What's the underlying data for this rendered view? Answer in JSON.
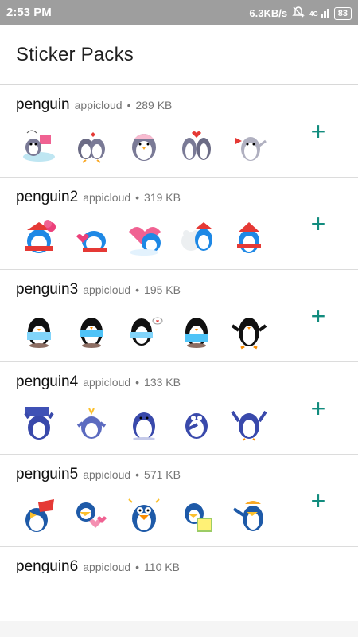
{
  "status": {
    "time": "2:53 PM",
    "network_speed": "6.3KB/s",
    "signal": "4G",
    "battery": "83"
  },
  "header": {
    "title": "Sticker Packs"
  },
  "accent_color": "#128c7e",
  "packs": [
    {
      "name": "penguin",
      "publisher": "appicloud",
      "size": "289 KB",
      "stickers": [
        "penguin-baby",
        "penguin-couple",
        "penguin-pink",
        "penguin-hug",
        "penguin-wave"
      ]
    },
    {
      "name": "penguin2",
      "publisher": "appicloud",
      "size": "319 KB",
      "stickers": [
        "penguin-flowers",
        "penguin-heart",
        "penguin-heart-balloon",
        "penguin-bear",
        "penguin-santa"
      ]
    },
    {
      "name": "penguin3",
      "publisher": "appicloud",
      "size": "195 KB",
      "stickers": [
        "penguin-scarf",
        "penguin-scarf-2",
        "penguin-love",
        "penguin-scarf-3",
        "penguin-arms"
      ]
    },
    {
      "name": "penguin4",
      "publisher": "appicloud",
      "size": "133 KB",
      "stickers": [
        "penguin-sign",
        "penguin-shock",
        "penguin-sit",
        "penguin-think",
        "penguin-dance"
      ]
    },
    {
      "name": "penguin5",
      "publisher": "appicloud",
      "size": "571 KB",
      "stickers": [
        "penguin-ha",
        "penguin-hearts",
        "penguin-angry",
        "penguin-sun",
        "penguin-hat"
      ]
    },
    {
      "name": "penguin6",
      "publisher": "appicloud",
      "size": "110 KB",
      "stickers": []
    }
  ]
}
